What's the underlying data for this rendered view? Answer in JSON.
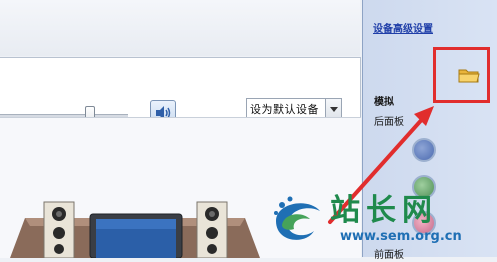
{
  "playback": {
    "volume_level": 0.72,
    "default_device_label": "设为默认设备"
  },
  "sidebar": {
    "advanced_link": "设备高级设置",
    "analog_label": "模拟",
    "rear_panel_label": "后面板",
    "front_panel_label": "前面板"
  },
  "annotation": {
    "highlight_color": "#e12d2d"
  },
  "watermark": {
    "title": "站长网",
    "url": "www.sem.org.cn"
  },
  "icons": {
    "speaker": "speaker-volume-icon",
    "folder": "folder-icon",
    "dropdown": "chevron-down-icon"
  }
}
